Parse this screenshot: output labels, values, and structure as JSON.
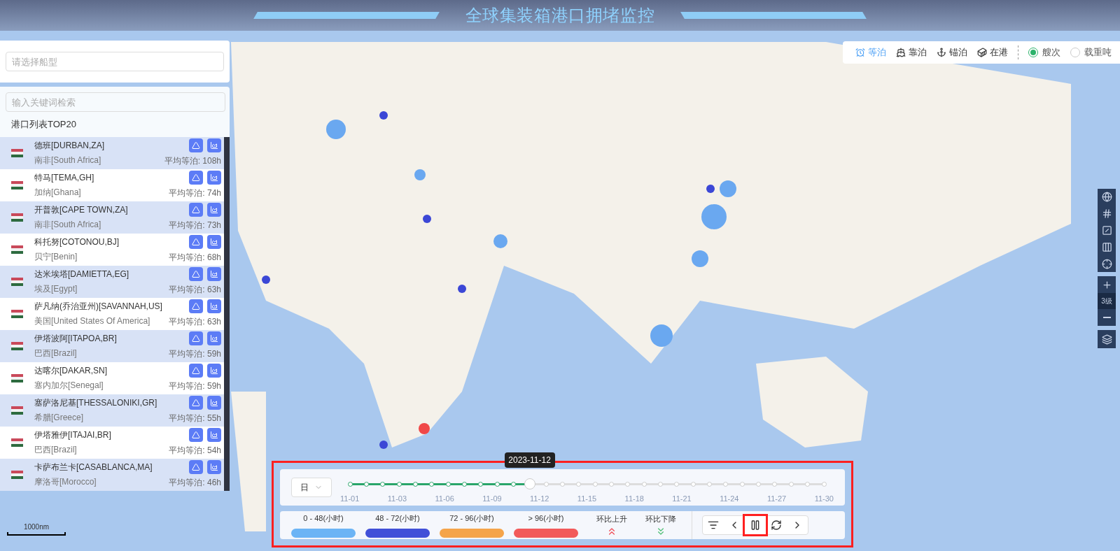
{
  "header": {
    "title": "全球集装箱港口拥堵监控"
  },
  "ship_type": {
    "placeholder": "请选择船型"
  },
  "port_search": {
    "placeholder": "输入关键词检索"
  },
  "port_list": {
    "title": "港口列表TOP20",
    "rows": [
      {
        "name": "德班[DURBAN,ZA]",
        "country": "南非[South Africa]",
        "wait": "平均等泊: 108h",
        "selected": true
      },
      {
        "name": "特马[TEMA,GH]",
        "country": "加纳[Ghana]",
        "wait": "平均等泊: 74h",
        "selected": false
      },
      {
        "name": "开普敦[CAPE TOWN,ZA]",
        "country": "南非[South Africa]",
        "wait": "平均等泊: 73h",
        "selected": true
      },
      {
        "name": "科托努[COTONOU,BJ]",
        "country": "贝宁[Benin]",
        "wait": "平均等泊: 68h",
        "selected": false
      },
      {
        "name": "达米埃塔[DAMIETTA,EG]",
        "country": "埃及[Egypt]",
        "wait": "平均等泊: 63h",
        "selected": true
      },
      {
        "name": "萨凡纳(乔治亚州)[SAVANNAH,US]",
        "country": "美国[United States Of America]",
        "wait": "平均等泊: 63h",
        "selected": false
      },
      {
        "name": "伊塔波阿[ITAPOA,BR]",
        "country": "巴西[Brazil]",
        "wait": "平均等泊: 59h",
        "selected": true
      },
      {
        "name": "达喀尔[DAKAR,SN]",
        "country": "塞内加尔[Senegal]",
        "wait": "平均等泊: 59h",
        "selected": false
      },
      {
        "name": "塞萨洛尼基[THESSALONIKI,GR]",
        "country": "希腊[Greece]",
        "wait": "平均等泊: 55h",
        "selected": true
      },
      {
        "name": "伊塔雅伊[ITAJAI,BR]",
        "country": "巴西[Brazil]",
        "wait": "平均等泊: 54h",
        "selected": false
      },
      {
        "name": "卡萨布兰卡[CASABLANCA,MA]",
        "country": "摩洛哥[Morocco]",
        "wait": "平均等泊: 46h",
        "selected": true
      }
    ]
  },
  "status_tabs": [
    {
      "label": "等泊",
      "kind": "clock",
      "selected": true
    },
    {
      "label": "靠泊",
      "kind": "ship",
      "selected": false
    },
    {
      "label": "锚泊",
      "kind": "anchor",
      "selected": false
    },
    {
      "label": "在港",
      "kind": "crane",
      "selected": false
    }
  ],
  "measure": [
    {
      "label": "艘次",
      "selected": true
    },
    {
      "label": "载重吨",
      "selected": false
    }
  ],
  "map_tools": {
    "zoom_level": "3级"
  },
  "scale": "1000nm",
  "timeline": {
    "granularity": "日",
    "current": "2023-11-12",
    "level": 0.379,
    "ticks": [
      "11-01",
      "11-03",
      "11-06",
      "11-09",
      "11-12",
      "11-15",
      "11-18",
      "11-21",
      "11-24",
      "11-27",
      "11-30"
    ]
  },
  "legend": [
    {
      "label": "0 - 48(小时)",
      "color": "#6cb4f5"
    },
    {
      "label": "48 - 72(小时)",
      "color": "#4150d8"
    },
    {
      "label": "72 - 96(小时)",
      "color": "#f5a44a"
    },
    {
      "label": "> 96(小时)",
      "color": "#f25a5a"
    }
  ],
  "trends": [
    {
      "label": "环比上升",
      "kind": "up"
    },
    {
      "label": "环比下降",
      "kind": "down"
    }
  ],
  "playback": [
    {
      "kind": "filter",
      "selected": false
    },
    {
      "kind": "prev",
      "selected": false
    },
    {
      "kind": "pause",
      "selected": true
    },
    {
      "kind": "refresh",
      "selected": false
    },
    {
      "kind": "next",
      "selected": false
    }
  ]
}
